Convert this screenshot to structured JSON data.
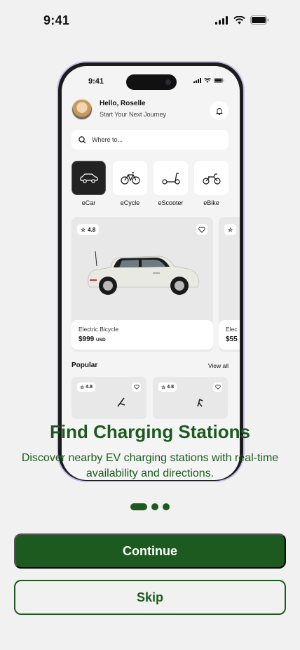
{
  "status_bar": {
    "time": "9:41"
  },
  "mockup": {
    "status_time": "9:41",
    "greeting": "Hello, Roselle",
    "subtitle": "Start Your Next Journey",
    "search_placeholder": "Where to...",
    "categories": [
      {
        "label": "eCar",
        "icon": "car-icon"
      },
      {
        "label": "eCycle",
        "icon": "bicycle-icon"
      },
      {
        "label": "eScooter",
        "icon": "scooter-icon"
      },
      {
        "label": "eBike",
        "icon": "motorbike-icon"
      }
    ],
    "featured": [
      {
        "rating": "4.8",
        "name": "Electric Bicycle",
        "price": "$999",
        "unit": "USD"
      },
      {
        "rating": "",
        "name": "Elec",
        "price": "$55",
        "unit": ""
      }
    ],
    "popular_title": "Popular",
    "view_all": "View all",
    "popular_items": [
      {
        "rating": "4.8"
      },
      {
        "rating": "4.8"
      }
    ]
  },
  "onboarding": {
    "title": "Find Charging Stations",
    "description": "Discover nearby EV charging stations with real-time availability and directions.",
    "step_total": 3,
    "step_current": 1,
    "continue_label": "Continue",
    "skip_label": "Skip"
  },
  "colors": {
    "primary": "#1d5a1f",
    "background": "#f1f1f1"
  }
}
